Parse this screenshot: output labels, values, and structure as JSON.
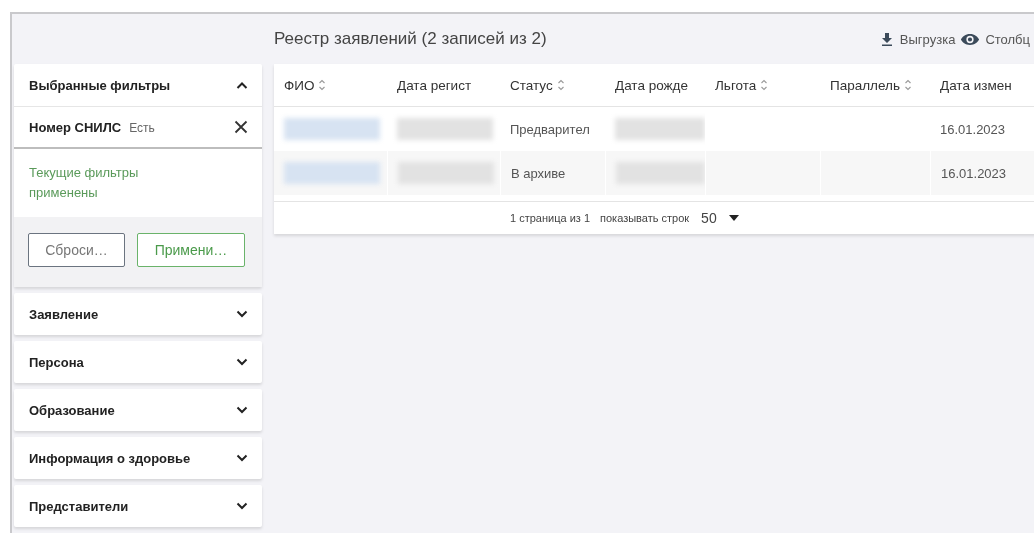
{
  "header": {
    "title": "Реестр заявлений (2 записей из 2)",
    "actions": [
      {
        "label": "Выгрузка",
        "kind": "export"
      },
      {
        "label": "Столбц",
        "kind": "columns"
      }
    ]
  },
  "filters": {
    "title": "Выбранные фильтры",
    "expanded": true,
    "chips": [
      {
        "label": "Номер СНИЛС",
        "value": "Есть"
      }
    ],
    "status": "Текущие фильтры применены",
    "buttons": [
      {
        "label": "Сброси…",
        "kind": "secondary"
      },
      {
        "label": "Примени…",
        "kind": "primary"
      }
    ],
    "sections": [
      {
        "label": "Заявление",
        "expanded": false
      },
      {
        "label": "Персона",
        "expanded": false
      },
      {
        "label": "Образование",
        "expanded": false
      },
      {
        "label": "Информация о здоровье",
        "expanded": false
      },
      {
        "label": "Представители",
        "expanded": false
      }
    ]
  },
  "table": {
    "columns": [
      {
        "label": "ФИО",
        "sortable": true
      },
      {
        "label": "Дата регист",
        "sortable": false
      },
      {
        "label": "Статус",
        "sortable": true
      },
      {
        "label": "Дата рожде",
        "sortable": false
      },
      {
        "label": "Льгота",
        "sortable": true
      },
      {
        "label": "Параллель",
        "sortable": true
      },
      {
        "label": "Дата измен",
        "sortable": false
      }
    ],
    "rows": [
      {
        "cells": [
          {
            "kind": "redacted_link"
          },
          {
            "kind": "redacted"
          },
          {
            "kind": "text",
            "text": "Предварител"
          },
          {
            "kind": "redacted"
          },
          null,
          null,
          {
            "kind": "text",
            "text": "16.01.2023"
          }
        ]
      },
      {
        "cells": [
          {
            "kind": "redacted_link"
          },
          {
            "kind": "redacted"
          },
          {
            "kind": "text",
            "text": "В архиве"
          },
          {
            "kind": "redacted"
          },
          null,
          null,
          {
            "kind": "text",
            "text": "16.01.2023"
          }
        ]
      }
    ],
    "pagination": {
      "page_info": "1 страница из 1",
      "rows_label": "показывать строк",
      "rows_value": "50"
    }
  }
}
